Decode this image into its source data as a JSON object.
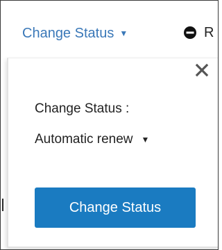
{
  "toolbar": {
    "change_status_label": "Change Status",
    "change_status_caret": "▼",
    "remove_label": "R",
    "remove_icon": "minus-circle-icon"
  },
  "popover": {
    "close_glyph": "close-x-icon",
    "field_label": "Change Status :",
    "selected_status": "Automatic renew",
    "select_caret": "▼",
    "submit_label": "Change Status"
  },
  "colors": {
    "link_blue": "#3a78b8",
    "button_blue": "#1a7bc1",
    "text_dark": "#222222",
    "close_gray": "#555555"
  }
}
